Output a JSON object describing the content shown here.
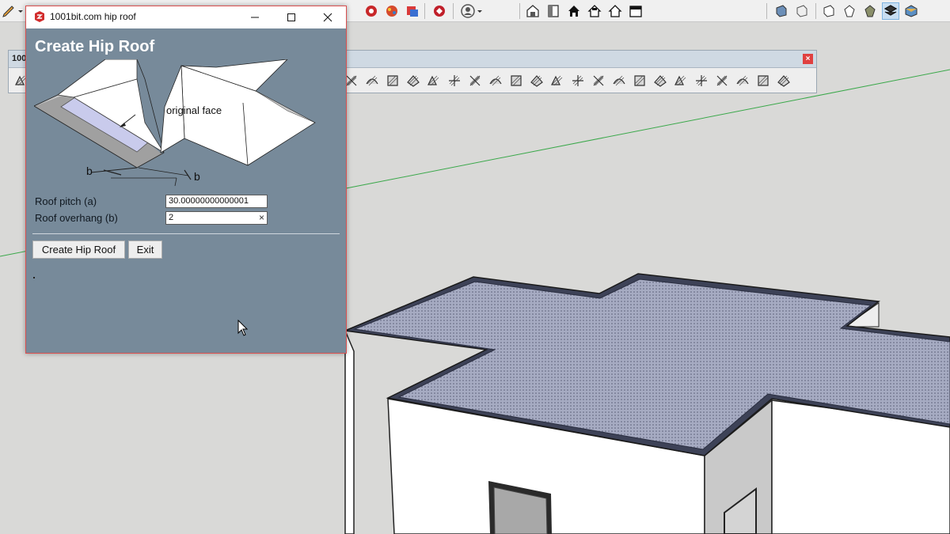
{
  "dialog": {
    "window_title": "1001bit.com hip roof",
    "heading": "Create Hip Roof",
    "diagram_label": "original face",
    "diagram_b_left": "b",
    "diagram_b_right": "b",
    "fields": [
      {
        "label": "Roof pitch (a)",
        "value": "30.00000000000001"
      },
      {
        "label": "Roof overhang (b)",
        "value": "2"
      }
    ],
    "clear_glyph": "×",
    "buttons": {
      "create": "Create Hip Roof",
      "exit": "Exit"
    }
  },
  "float_toolbar": {
    "title": "100",
    "close": "×"
  },
  "icons": {
    "main_toolbar": [
      "pencil-icon",
      "dropdown-icon",
      "component-red-icon",
      "component-multi-icon",
      "layer-red-icon",
      "ruby-icon",
      "account-icon",
      "dropdown-icon",
      "warehouse-3d-icon",
      "extension-icon",
      "house-icon",
      "house-outline-icon",
      "storage-icon",
      "storage2-icon",
      "iso-view-icon",
      "top-view-icon",
      "front-view-icon",
      "right-view-icon",
      "back-view-icon",
      "shaded-style-icon",
      "textured-style-icon"
    ],
    "float_toolbar_count": 24
  },
  "colors": {
    "dialog_bg": "#778a9a",
    "viewport_bg": "#d9d9d7",
    "roof_top": "#9aa0b8",
    "wall": "#ffffff",
    "axis_green": "#3aa84a"
  }
}
